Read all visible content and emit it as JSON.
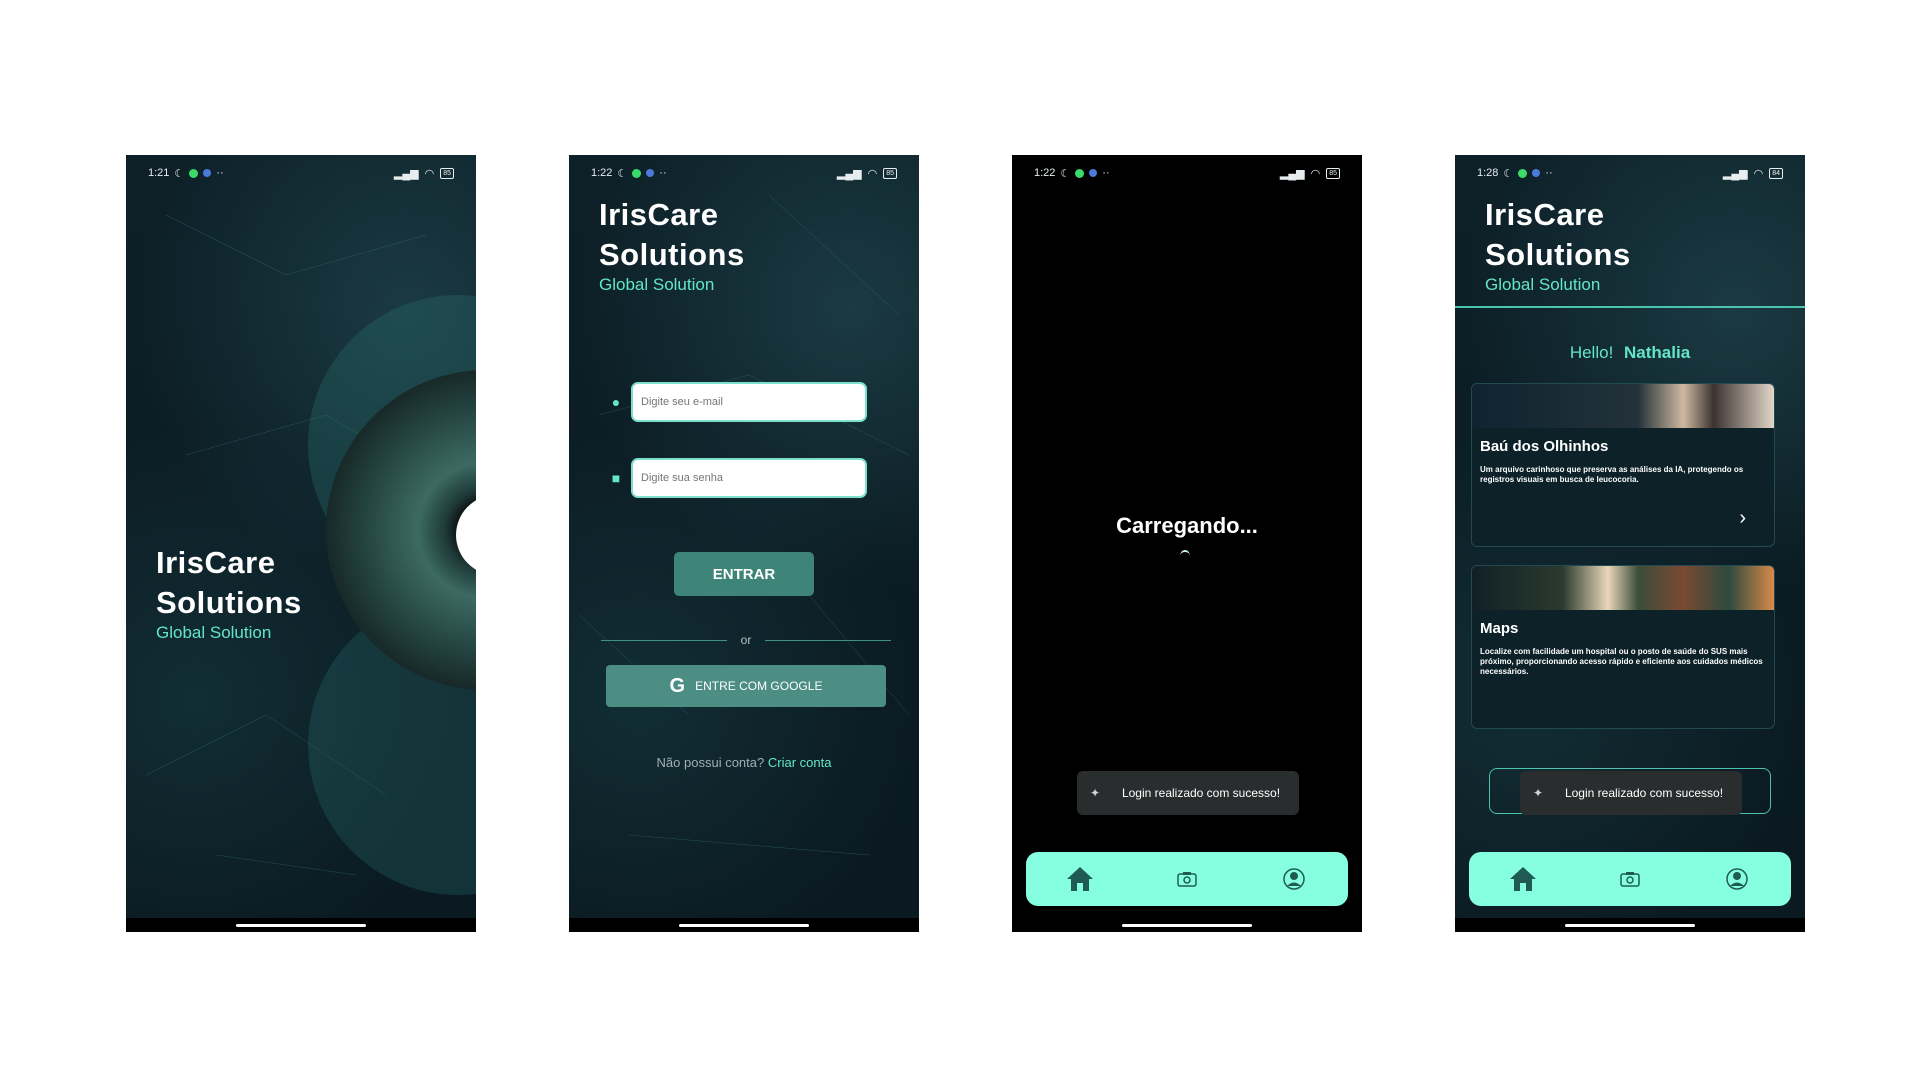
{
  "screens": [
    {
      "status": {
        "time": "1:21",
        "battery": "85"
      },
      "brand": {
        "title_line1": "IrisCare",
        "title_line2": "Solutions",
        "subtitle": "Global Solution"
      }
    },
    {
      "status": {
        "time": "1:22",
        "battery": "85"
      },
      "brand": {
        "title_line1": "IrisCare",
        "title_line2": "Solutions",
        "subtitle": "Global Solution"
      },
      "email_placeholder": "Digite seu e-mail",
      "password_placeholder": "Digite sua senha",
      "login_button": "ENTRAR",
      "divider": "or",
      "google_button": "ENTRE COM GOOGLE",
      "google_icon": "G",
      "signup_prompt": "Não possui conta?",
      "signup_link": "Criar conta"
    },
    {
      "status": {
        "time": "1:22",
        "battery": "85"
      },
      "loading_text": "Carregando...",
      "toast": "Login realizado com sucesso!"
    },
    {
      "status": {
        "time": "1:28",
        "battery": "84"
      },
      "brand": {
        "title_line1": "IrisCare",
        "title_line2": "Solutions",
        "subtitle": "Global Solution"
      },
      "greeting": "Hello!",
      "user_name": "Nathalia",
      "cards": [
        {
          "title": "Baú dos Olhinhos",
          "description": "Um arquivo carinhoso que preserva as análises da IA, protegendo os registros visuais em busca de leucocoria."
        },
        {
          "title": "Maps",
          "description": "Localize com facilidade um hospital ou o posto de saúde do SUS mais próximo, proporcionando acesso rápido e eficiente aos cuidados médicos necessários."
        }
      ],
      "toast": "Login realizado com sucesso!"
    }
  ],
  "nav": {
    "icons": [
      "home-icon",
      "camera-icon",
      "profile-icon"
    ],
    "bar_color": "#86ffe0",
    "icon_color": "#1f5b52"
  },
  "colors": {
    "accent": "#63e6c7",
    "background": "#0c1e26",
    "button": "#3e8478"
  }
}
